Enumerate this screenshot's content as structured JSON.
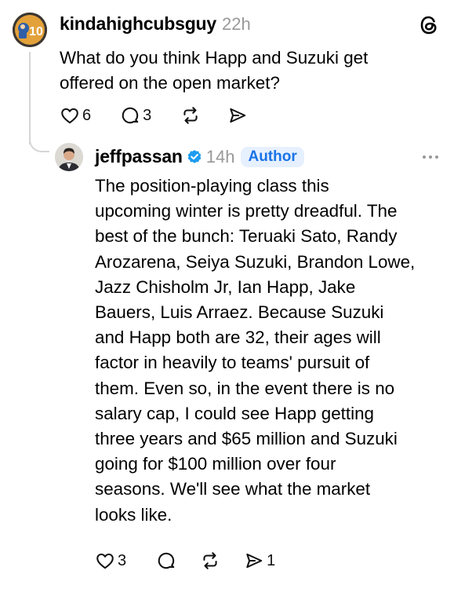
{
  "app": {
    "logo_icon": "threads-logo-icon"
  },
  "parent_post": {
    "username": "kindahighcubsguy",
    "time": "22h",
    "text_lines": [
      "What do you think Happ and Suzuki get",
      "offered on the open market?"
    ],
    "likes": "6",
    "comments": "3"
  },
  "reply_post": {
    "username": "jeffpassan",
    "time": "14h",
    "badge": "Author",
    "verified_color": "#1d9bf0",
    "text_lines": [
      "The position-playing class this",
      "upcoming winter is pretty dreadful. The",
      "best of the bunch: Teruaki Sato, Randy",
      "Arozarena, Seiya Suzuki, Brandon Lowe,",
      "Jazz Chisholm Jr, Ian Happ, Jake",
      "Bauers, Luis Arraez. Because Suzuki",
      "and Happ both are 32, their ages will",
      "factor in heavily to teams' pursuit of",
      "them. Even so, in the event there is no",
      "salary cap, I could see Happ getting",
      "three years and $65 million and Suzuki",
      "going for $100 million over four",
      "seasons. We'll see what the market",
      "looks like."
    ],
    "likes": "3",
    "shares": "1"
  }
}
